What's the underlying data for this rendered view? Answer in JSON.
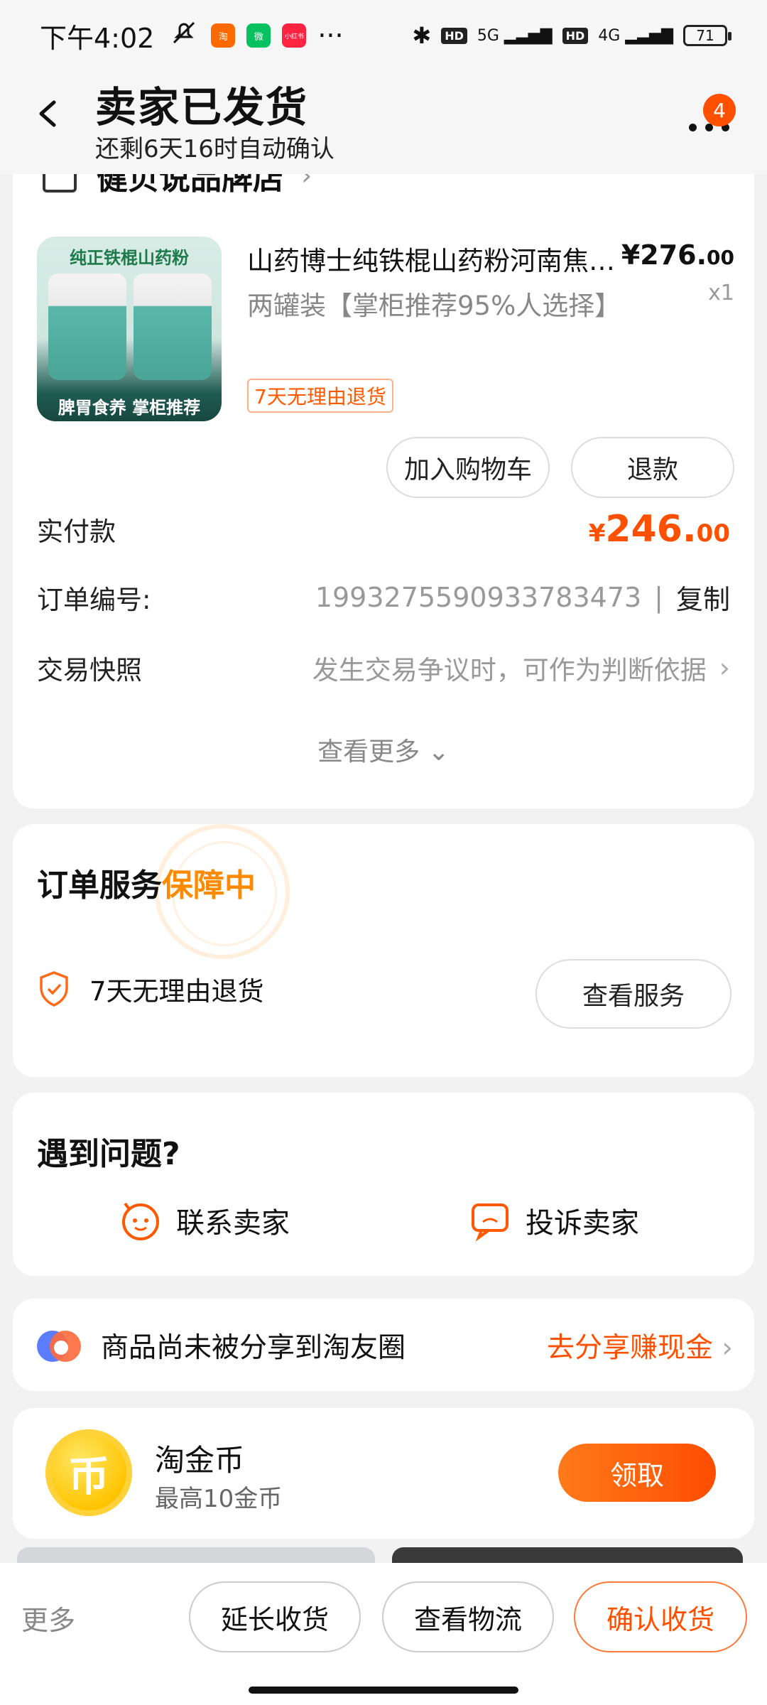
{
  "status_bar": {
    "time": "下午4:02",
    "apps": [
      {
        "icon": "taobao-icon",
        "label": "淘",
        "color": "#ff6a00"
      },
      {
        "icon": "wechat-icon",
        "label": "微",
        "color": "#07c160"
      },
      {
        "icon": "xiaohongshu-icon",
        "label": "小红书",
        "color": "#ff2442"
      }
    ],
    "more": "···",
    "signal1": "5G",
    "signal2": "4G",
    "hd": "HD",
    "battery": "71"
  },
  "header": {
    "title": "卖家已发货",
    "subtitle": "还剩6天16时自动确认",
    "badge_count": "4"
  },
  "shop": {
    "name": "健贝说品牌店"
  },
  "product": {
    "image_top_text": "纯正铁棍山药粉",
    "image_bottom_text": "脾胃食养 掌柜推荐",
    "title": "山药博士纯铁棍山药粉河南焦作温县正宗",
    "price_symbol": "¥",
    "price_int": "276.",
    "price_dec": "00",
    "quantity": "x1",
    "spec": "两罐装【掌柜推荐95%人选择】",
    "return_tag": "7天无理由退货",
    "add_cart_label": "加入购物车",
    "refund_label": "退款"
  },
  "order": {
    "paid_label": "实付款",
    "paid_symbol": "¥",
    "paid_int": "246.",
    "paid_dec": "00",
    "order_no_label": "订单编号:",
    "order_no": "1993275590933783473",
    "separator": "|",
    "copy_label": "复制",
    "snapshot_label": "交易快照",
    "snapshot_text": "发生交易争议时，可作为判断依据",
    "see_more": "查看更多"
  },
  "service": {
    "title": "订单服务",
    "status": "保障中",
    "item": "7天无理由退货",
    "button": "查看服务"
  },
  "help": {
    "title": "遇到问题?",
    "contact": "联系卖家",
    "complain": "投诉卖家"
  },
  "share": {
    "text": "商品尚未被分享到淘友圈",
    "link": "去分享赚现金"
  },
  "coins": {
    "symbol": "币",
    "title": "淘金币",
    "subtitle": "最高10金币",
    "button": "领取"
  },
  "bottom_bar": {
    "more": "更多",
    "extend": "延长收货",
    "logistics": "查看物流",
    "confirm": "确认收货"
  },
  "colors": {
    "accent": "#ff5000",
    "service": "#ff8a00"
  }
}
